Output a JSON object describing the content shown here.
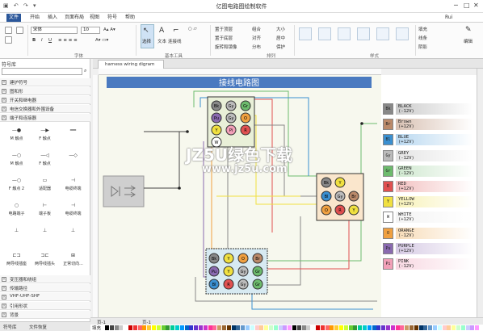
{
  "titlebar": {
    "title": "亿图电路图绘制软件",
    "user": "Rui"
  },
  "menu": [
    "文件",
    "开始",
    "插入",
    "页面布局",
    "视图",
    "符号",
    "帮助"
  ],
  "ribbon": {
    "font_name": "宋体",
    "font_size": "10",
    "groups": [
      "字体",
      "基本工具",
      "排列",
      "样式"
    ],
    "select": "选择",
    "text": "文本",
    "connector": "连接线",
    "arrange": [
      "置于顶层",
      "组合",
      "大小",
      "置于底层",
      "对齐",
      "居中",
      "旋转和镜像",
      "分布",
      "保护"
    ],
    "right": [
      "填充",
      "线条",
      "阴影",
      "编辑"
    ]
  },
  "left_panel": {
    "title": "符号库",
    "categories_top": [
      "建护符号",
      "图和形",
      "开关和继电器",
      "电信交换器和外围设备",
      "端子和连接器"
    ],
    "shapes": [
      {
        "label": "M 触点",
        "glyph": "—●"
      },
      {
        "label": "F 触点",
        "glyph": "—▶"
      },
      {
        "label": "",
        "glyph": "━━"
      },
      {
        "label": "M 触点",
        "glyph": "—○"
      },
      {
        "label": "F 触点",
        "glyph": "—◁"
      },
      {
        "label": "",
        "glyph": "—◇"
      },
      {
        "label": "F 触点 2",
        "glyph": "—○"
      },
      {
        "label": "适配器",
        "glyph": "▭"
      },
      {
        "label": "电缆终端",
        "glyph": "⊣"
      },
      {
        "label": "电路端子",
        "glyph": "○"
      },
      {
        "label": "端子板",
        "glyph": "⊢"
      },
      {
        "label": "电缆终端",
        "glyph": "⊣"
      },
      {
        "label": "",
        "glyph": "⊥"
      },
      {
        "label": "",
        "glyph": "⊥"
      },
      {
        "label": "",
        "glyph": "⊥"
      },
      {
        "label": "两导线插座",
        "glyph": "⊏⊐"
      },
      {
        "label": "两导线插头",
        "glyph": "⊐⊏"
      },
      {
        "label": "正常切向...",
        "glyph": "⊞"
      }
    ],
    "categories_bottom": [
      "变压器和绕组",
      "传输路径",
      "VHF-UHF-SHF",
      "引用形状",
      "背景"
    ],
    "bottom_tabs": [
      "符号库",
      "文件恢复"
    ]
  },
  "doc_tab": "harness wiring digram",
  "diagram": {
    "title": "接线电路图",
    "connector_top": [
      [
        "Bk",
        "Gy",
        "Gr"
      ],
      [
        "Pu",
        "Gy",
        "O"
      ],
      [
        "Y",
        "Pi",
        "R"
      ],
      [
        "W"
      ]
    ],
    "connector_right": [
      [
        "Bk",
        "Y"
      ],
      [
        "Bl",
        "Gy",
        "Br"
      ],
      [
        "O",
        "R",
        "Y"
      ]
    ],
    "connector_bottom": [
      [
        "Bk",
        "Y",
        "O",
        "Br"
      ],
      [
        "Pu",
        "Y",
        "Gy",
        "Gr"
      ],
      [
        "Bl",
        "R",
        "Gy",
        "Gr"
      ]
    ]
  },
  "legend": [
    {
      "code": "Bk",
      "name": "BLACK",
      "v": "(-12V)",
      "color": "#888888",
      "bg": "#cccccc"
    },
    {
      "code": "Br",
      "name": "Brown",
      "v": "(+12V)",
      "color": "#bb8a6a",
      "bg": "#d9c2b4"
    },
    {
      "code": "Bl",
      "name": "BLUE",
      "v": "(+12V)",
      "color": "#3a8fd0",
      "bg": "#b9d8f0"
    },
    {
      "code": "Gy",
      "name": "GREY",
      "v": "(-12V)",
      "color": "#bbbbbb",
      "bg": "#e5e5e5"
    },
    {
      "code": "Gr",
      "name": "GREEN",
      "v": "(-12V)",
      "color": "#6dbb6d",
      "bg": "#cfe8cf"
    },
    {
      "code": "R",
      "name": "RED",
      "v": "(+12V)",
      "color": "#e05050",
      "bg": "#f3c2c2"
    },
    {
      "code": "Y",
      "name": "YELLOW",
      "v": "(+12V)",
      "color": "#f0e040",
      "bg": "#f8f2b8"
    },
    {
      "code": "W",
      "name": "WHITE",
      "v": "(+12V)",
      "color": "#ffffff",
      "bg": "#f4f4f4"
    },
    {
      "code": "O",
      "name": "ORANGE",
      "v": "(-12V)",
      "color": "#f0a040",
      "bg": "#f8dcb8"
    },
    {
      "code": "Pu",
      "name": "PURPLE",
      "v": "(+12V)",
      "color": "#8a6ab0",
      "bg": "#d6cae4"
    },
    {
      "code": "Pi",
      "name": "PINK",
      "v": "(-12V)",
      "color": "#f2a0b8",
      "bg": "#f8d8e2"
    }
  ],
  "pagebar": {
    "page_left": "页-1",
    "page_tab": "页-1"
  },
  "fill_label": "填充",
  "watermark": {
    "line1": "JZ5U绿色下载",
    "line2": "www.jz5u.com"
  }
}
